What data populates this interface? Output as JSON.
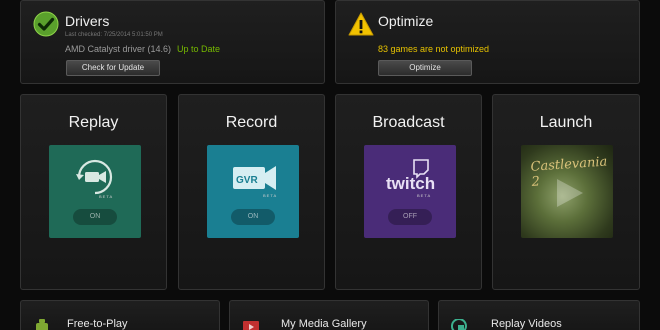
{
  "drivers": {
    "title": "Drivers",
    "last_checked": "Last checked: 7/25/2014 5:01:50 PM",
    "driver_name": "AMD Catalyst driver (14.6)",
    "status": "Up to Date",
    "button_label": "Check for Update"
  },
  "optimize": {
    "title": "Optimize",
    "status": "83 games are not optimized",
    "button_label": "Optimize"
  },
  "features": [
    {
      "title": "Replay",
      "toggle": "ON",
      "badge": "BETA",
      "tile_color": "#1f6a57"
    },
    {
      "title": "Record",
      "toggle": "ON",
      "badge": "BETA",
      "icon_text": "GVR",
      "tile_color": "#1a7f92"
    },
    {
      "title": "Broadcast",
      "toggle": "OFF",
      "badge": "BETA",
      "icon_text": "twitch",
      "tile_color": "#4a2c78"
    },
    {
      "title": "Launch",
      "game_art_text": "Castlevania 2"
    }
  ],
  "bottom": [
    {
      "label": "Free-to-Play"
    },
    {
      "label": "My Media Gallery"
    },
    {
      "label": "Replay Videos"
    }
  ],
  "colors": {
    "accent_green": "#76b900",
    "warning_yellow": "#e6c200"
  }
}
